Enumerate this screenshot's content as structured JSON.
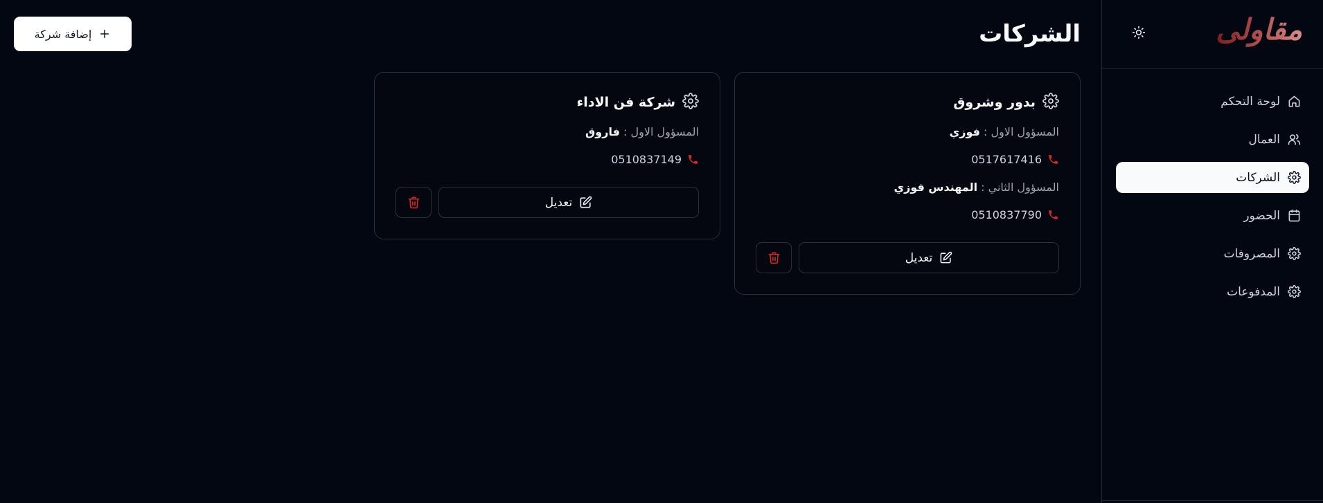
{
  "app": {
    "brand": "مقاولى"
  },
  "colors": {
    "background": "#030712",
    "accent": "#b45454",
    "danger": "#dc2626",
    "active_item": "#f8fafc"
  },
  "sidebar": {
    "items": [
      {
        "label": "لوحة التحكم",
        "icon": "home-icon",
        "active": false
      },
      {
        "label": "العمال",
        "icon": "users-icon",
        "active": false
      },
      {
        "label": "الشركات",
        "icon": "gear-icon",
        "active": true
      },
      {
        "label": "الحضور",
        "icon": "calendar-icon",
        "active": false
      },
      {
        "label": "المصروفات",
        "icon": "gear-icon",
        "active": false
      },
      {
        "label": "المدفوعات",
        "icon": "gear-icon",
        "active": false
      }
    ]
  },
  "header": {
    "title": "الشركات",
    "add_button_label": "إضافة شركة"
  },
  "companies": [
    {
      "name": "بدور وشروق",
      "contact1_label": "المسؤول الاول :",
      "contact1_name": "فوزي",
      "phone1": "0517617416",
      "contact2_label": "المسؤول الثاني :",
      "contact2_name": "المهندس فوزي",
      "phone2": "0510837790",
      "edit_label": "تعديل"
    },
    {
      "name": "شركة فن الاداء",
      "contact1_label": "المسؤول الاول :",
      "contact1_name": "فاروق",
      "phone1": "0510837149",
      "edit_label": "تعديل"
    }
  ]
}
